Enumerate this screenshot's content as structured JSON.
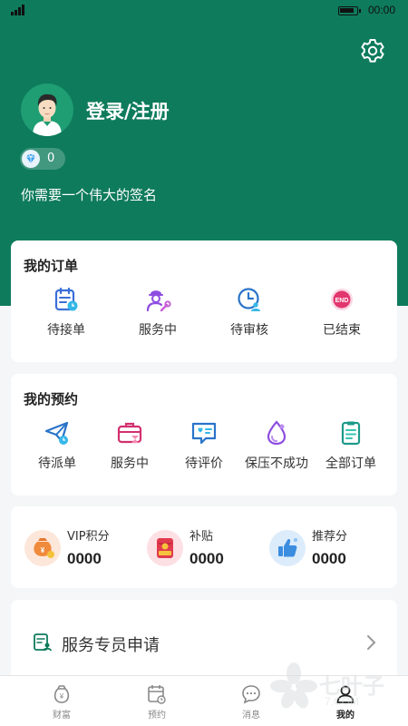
{
  "status_bar": {
    "time": "00:00"
  },
  "profile": {
    "login_label": "登录/注册",
    "gem_count": "0",
    "signature": "你需要一个伟大的签名"
  },
  "orders": {
    "title": "我的订单",
    "items": [
      {
        "label": "待接单",
        "icon": "order-calendar-icon"
      },
      {
        "label": "服务中",
        "icon": "worker-wrench-icon"
      },
      {
        "label": "待审核",
        "icon": "clock-person-icon"
      },
      {
        "label": "已结束",
        "icon": "end-badge-icon"
      }
    ]
  },
  "appointments": {
    "title": "我的预约",
    "items": [
      {
        "label": "待派单",
        "icon": "paper-plane-icon"
      },
      {
        "label": "服务中",
        "icon": "briefcase-hourglass-icon"
      },
      {
        "label": "待评价",
        "icon": "review-chat-icon"
      },
      {
        "label": "保压不成功",
        "icon": "drop-icon"
      },
      {
        "label": "全部订单",
        "icon": "document-list-icon"
      }
    ]
  },
  "points": [
    {
      "label": "VIP积分",
      "value": "0000",
      "icon": "money-bag-icon",
      "bg": "#fde7da"
    },
    {
      "label": "补贴",
      "value": "0000",
      "icon": "red-packet-icon",
      "bg": "#fde0e4"
    },
    {
      "label": "推荐分",
      "value": "0000",
      "icon": "thumbs-up-icon",
      "bg": "#dcecfb"
    }
  ],
  "service": {
    "label": "服务专员申请"
  },
  "tabbar": {
    "items": [
      {
        "label": "财富",
        "icon": "wealth-icon",
        "active": false
      },
      {
        "label": "预约",
        "icon": "calendar-icon",
        "active": false
      },
      {
        "label": "消息",
        "icon": "message-icon",
        "active": false
      },
      {
        "label": "我的",
        "icon": "person-icon",
        "active": true
      }
    ]
  },
  "watermark": {
    "text": "七叶子",
    "sub": "7.COM"
  },
  "colors": {
    "brand": "#0e7b5c",
    "background": "#f5f6f7"
  }
}
